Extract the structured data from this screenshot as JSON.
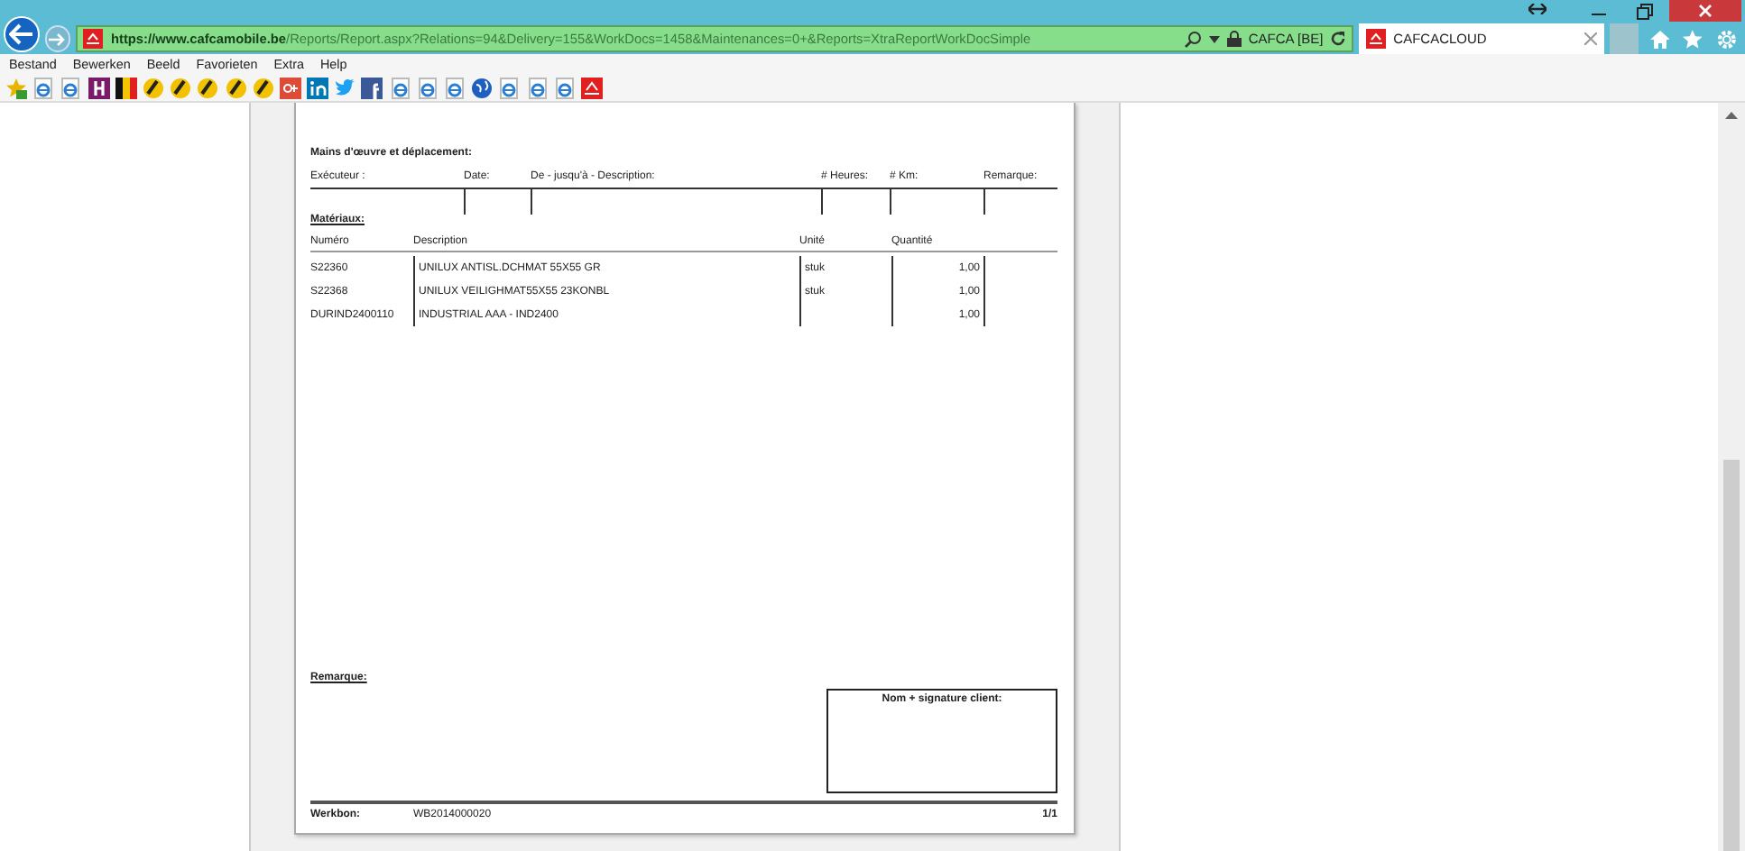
{
  "browser": {
    "address": "**https://www.cafcamobile.be**/Reports/Report.aspx?Relations=94&Delivery=155&WorkDocs=1458&Maintenances=0+&Reports=XtraReportWorkDocSimple",
    "site_identity": "CAFCA [BE]",
    "tab": {
      "title": "CAFCACLOUD",
      "selected": true
    },
    "menu": [
      "Bestand",
      "Bewerken",
      "Beeld",
      "Favorieten",
      "Extra",
      "Help"
    ]
  },
  "report": {
    "labour": {
      "title": "Mains d'œuvre et déplacement:",
      "columns": [
        "Exécuteur :",
        "Date:",
        "De - jusqu'à - Description:",
        "# Heures:",
        "# Km:",
        "Remarque:"
      ]
    },
    "materials": {
      "title": "Matériaux:",
      "columns": [
        "Numéro",
        "Description",
        "Unité",
        "Quantité"
      ],
      "rows": [
        {
          "number": "S22360",
          "description": "UNILUX ANTISL.DCHMAT 55X55 GR",
          "unit": "stuk",
          "quantity": "1,00"
        },
        {
          "number": "S22368",
          "description": "UNILUX VEILIGHMAT55X55 23KONBL",
          "unit": "stuk",
          "quantity": "1,00"
        },
        {
          "number": "DURIND2400110",
          "description": "INDUSTRIAL AAA - IND2400",
          "unit": "",
          "quantity": "1,00"
        }
      ]
    },
    "remark_label": "Remarque:",
    "signature_label": "Nom + signature client:",
    "footer": {
      "label": "Werkbon:",
      "number": "WB2014000020",
      "page": "1/1"
    }
  }
}
